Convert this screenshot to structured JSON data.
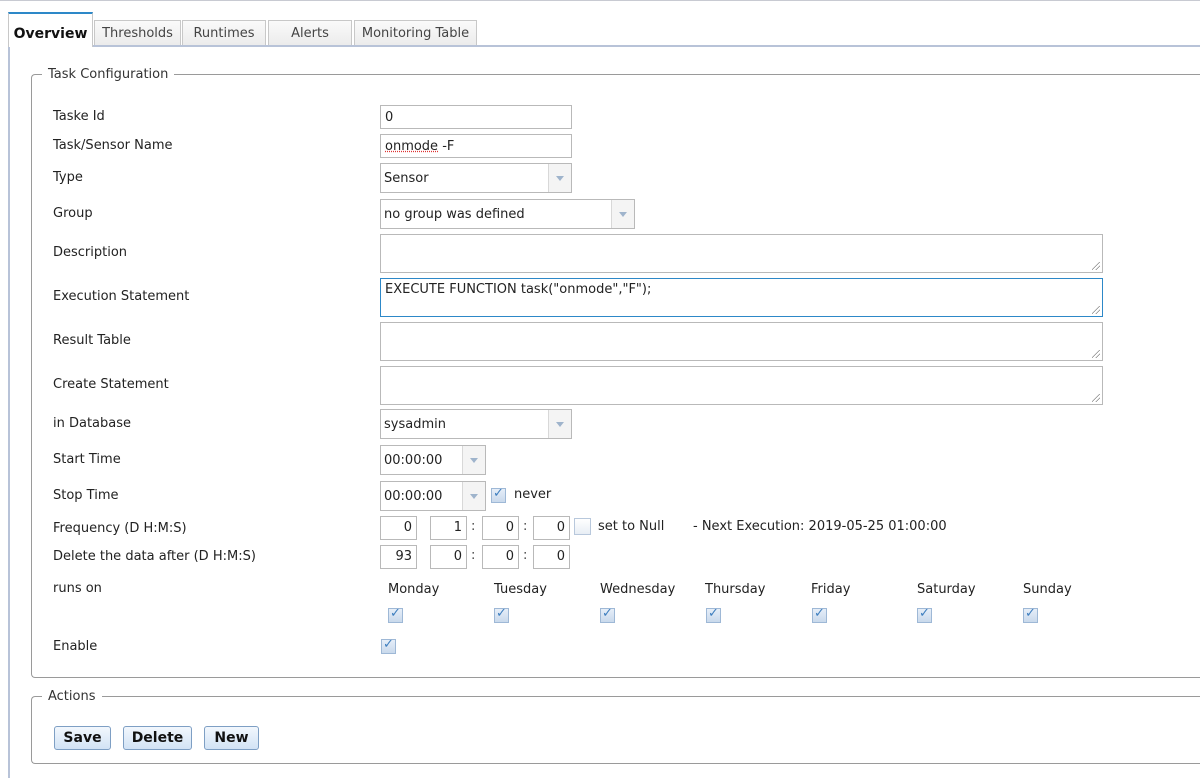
{
  "tabs": [
    {
      "label": "Overview",
      "active": true
    },
    {
      "label": "Thresholds",
      "active": false
    },
    {
      "label": "Runtimes",
      "active": false
    },
    {
      "label": "Alerts",
      "active": false
    },
    {
      "label": "Monitoring Table",
      "active": false
    }
  ],
  "task_config": {
    "legend": "Task Configuration",
    "labels": {
      "task_id": "Taske Id",
      "name": "Task/Sensor Name",
      "type": "Type",
      "group": "Group",
      "description": "Description",
      "execution": "Execution Statement",
      "result_table": "Result Table",
      "create_statement": "Create Statement",
      "database": "in Database",
      "start_time": "Start Time",
      "stop_time": "Stop Time",
      "frequency": "Frequency (D H:M:S)",
      "delete_after": "Delete the data after (D H:M:S)",
      "runs_on": "runs on",
      "enable": "Enable"
    },
    "values": {
      "task_id": "0",
      "name_part1": "onmode",
      "name_part2": " -F",
      "type": "Sensor",
      "group": "no group was defined",
      "description": "",
      "execution": "EXECUTE FUNCTION task(\"onmode\",\"F\");",
      "result_table": "",
      "create_statement": "",
      "database": "sysadmin",
      "start_time": "00:00:00",
      "stop_time": "00:00:00",
      "never_label": "never",
      "never_checked": true,
      "frequency": {
        "d": "0",
        "h": "1",
        "m": "0",
        "s": "0"
      },
      "set_null_label": "set to Null",
      "set_null_checked": false,
      "next_execution": "- Next Execution: 2019-05-25 01:00:00",
      "delete_after": {
        "d": "93",
        "h": "0",
        "m": "0",
        "s": "0"
      },
      "colon": ":",
      "days": [
        {
          "label": "Monday",
          "checked": true
        },
        {
          "label": "Tuesday",
          "checked": true
        },
        {
          "label": "Wednesday",
          "checked": true
        },
        {
          "label": "Thursday",
          "checked": true
        },
        {
          "label": "Friday",
          "checked": true
        },
        {
          "label": "Saturday",
          "checked": true
        },
        {
          "label": "Sunday",
          "checked": true
        }
      ],
      "enable_checked": true
    }
  },
  "actions": {
    "legend": "Actions",
    "save": "Save",
    "delete": "Delete",
    "new": "New"
  },
  "colors": {
    "accent": "#2d88c8",
    "button_border": "#7e9fc4",
    "tab_underline": "#b8c3d8"
  }
}
